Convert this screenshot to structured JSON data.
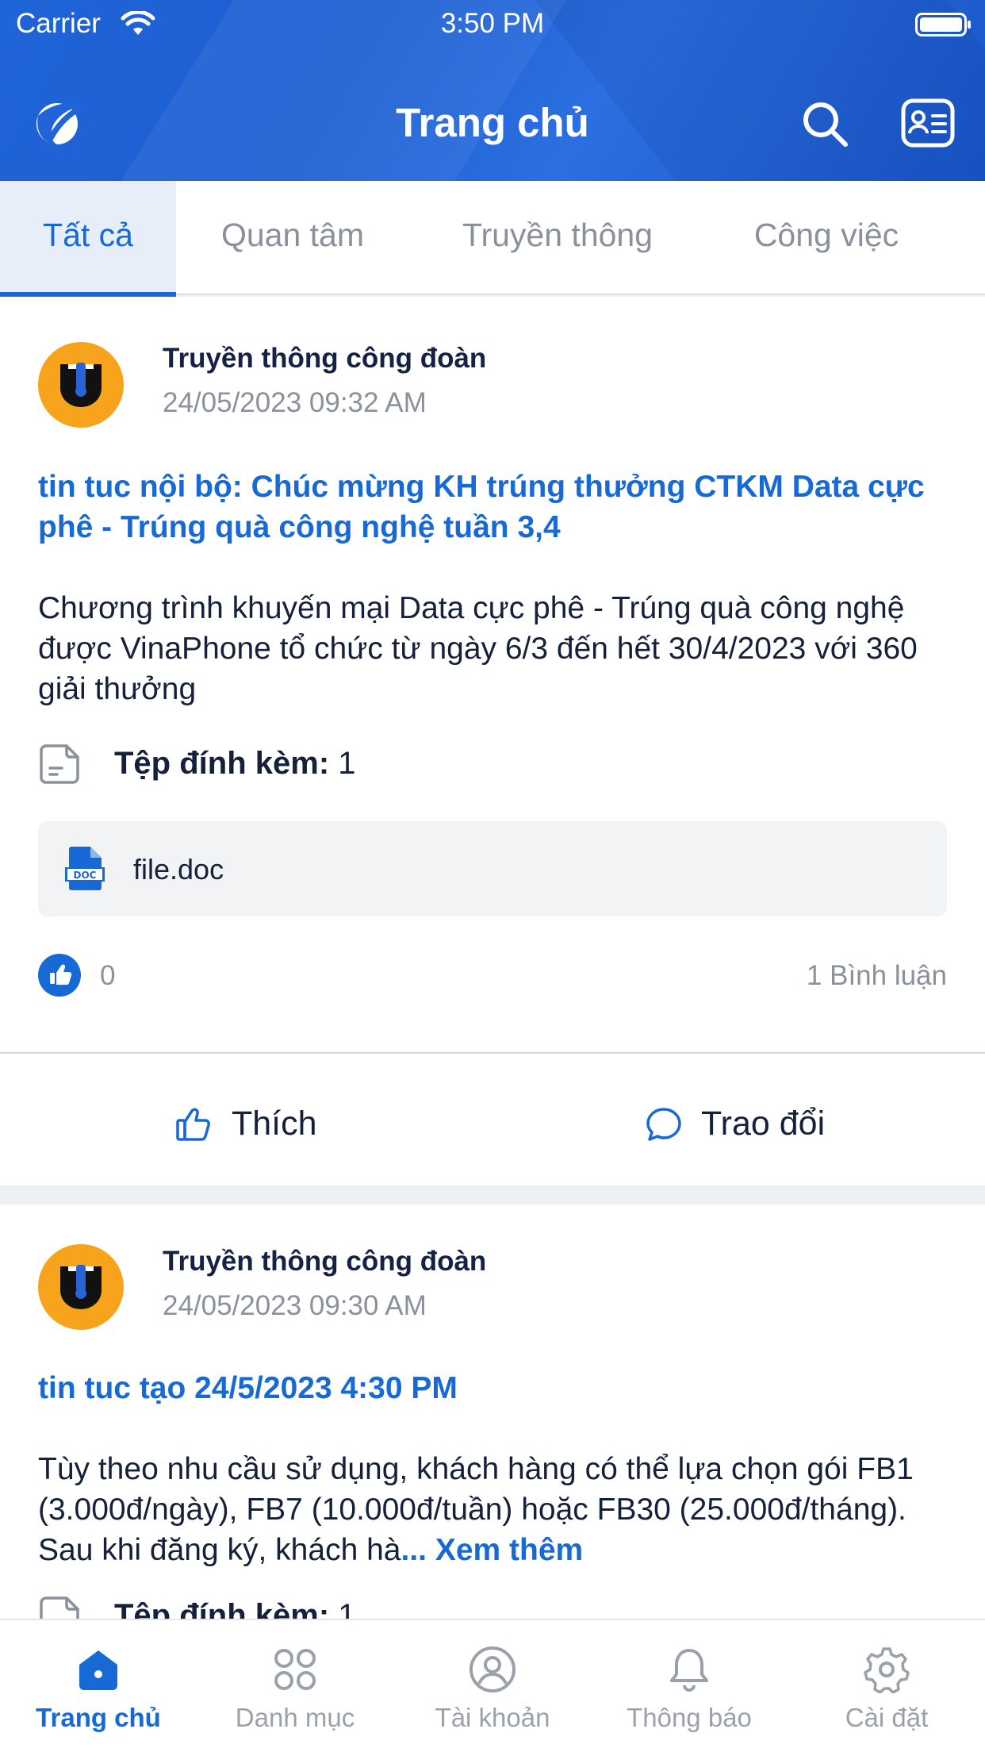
{
  "status_bar": {
    "carrier": "Carrier",
    "time": "3:50 PM"
  },
  "header": {
    "title": "Trang chủ",
    "logo_icon": "vnpt-logo",
    "search_icon": "search-icon",
    "card_icon": "id-card-icon"
  },
  "tabs": [
    {
      "label": "Tất cả",
      "active": true
    },
    {
      "label": "Quan tâm",
      "active": false
    },
    {
      "label": "Truyền thông",
      "active": false
    },
    {
      "label": "Công việc",
      "active": false
    }
  ],
  "posts": [
    {
      "author": "Truyền thông công đoàn",
      "date": "24/05/2023 09:32 AM",
      "title": "tin tuc nội bộ: Chúc mừng KH trúng thưởng CTKM Data cực phê - Trúng quà công nghệ tuần 3,4",
      "body": "Chương trình khuyến mại Data cực phê - Trúng quà công nghệ được VinaPhone tổ chức từ ngày 6/3 đến hết 30/4/2023 với 360 giải thưởng",
      "attachment_label": "Tệp đính kèm:",
      "attachment_count": "1",
      "file_name": "file.doc",
      "likes": "0",
      "comments": "1 Bình luận",
      "like_action": "Thích",
      "comment_action": "Trao đổi"
    },
    {
      "author": "Truyền thông công đoàn",
      "date": "24/05/2023 09:30 AM",
      "title": "tin tuc tạo 24/5/2023 4:30 PM",
      "body": "Tùy theo nhu cầu sử dụng, khách hàng có thể lựa chọn gói FB1 (3.000đ/ngày), FB7 (10.000đ/tuần) hoặc FB30 (25.000đ/tháng). Sau khi đăng ký, khách hà",
      "more": "... Xem thêm",
      "attachment_label": "Tệp đính kèm:",
      "attachment_count": "1"
    }
  ],
  "bottom_nav": [
    {
      "label": "Trang chủ",
      "icon": "home-icon",
      "active": true
    },
    {
      "label": "Danh mục",
      "icon": "grid-icon",
      "active": false
    },
    {
      "label": "Tài khoản",
      "icon": "user-icon",
      "active": false
    },
    {
      "label": "Thông báo",
      "icon": "bell-icon",
      "active": false
    },
    {
      "label": "Cài đặt",
      "icon": "settings-icon",
      "active": false
    }
  ],
  "colors": {
    "primary": "#1769d5",
    "header": "#1f64d8",
    "avatar": "#f7a41c",
    "muted": "#8a909c"
  }
}
